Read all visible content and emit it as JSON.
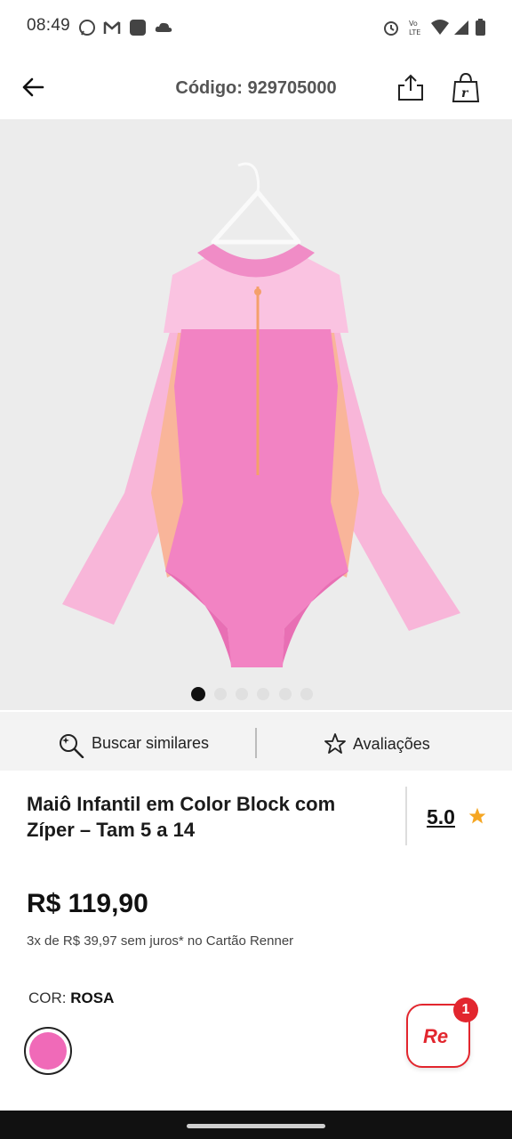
{
  "status_bar": {
    "time": "08:49",
    "icons": [
      "whatsapp-icon",
      "gmail-icon",
      "app-icon",
      "cloud-icon",
      "alarm-icon",
      "volte-icon",
      "wifi-icon",
      "signal-icon",
      "battery-icon"
    ]
  },
  "header": {
    "title": "Código: 929705000"
  },
  "gallery": {
    "image_alt": "Maiô rosa infantil com zíper",
    "page_count": 6,
    "active_index": 0
  },
  "actions": {
    "similar_label": "Buscar similares",
    "reviews_label": "Avaliações"
  },
  "product": {
    "name_line1": "Maiô Infantil em Color Block com",
    "name_line2": "Zíper – Tam 5 a 14",
    "rating": "5.0",
    "price": "R$ 119,90",
    "installments": "3x de R$ 39,97 sem juros* no Cartão Renner",
    "color_prefix": "COR: ",
    "color_name": "ROSA",
    "swatch_color": "#f06ab8"
  },
  "badge": {
    "text": "Re",
    "count": "1"
  },
  "colors": {
    "brand_red": "#e2262e",
    "star": "#f5a623"
  }
}
